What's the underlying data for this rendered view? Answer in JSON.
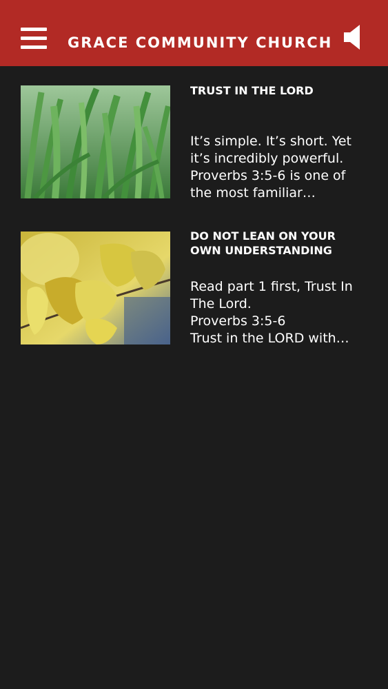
{
  "header": {
    "title": "GRACE COMMUNITY CHURCH",
    "menu_icon": "hamburger-menu-icon",
    "sound_icon": "speaker-icon",
    "background": "#b22a25"
  },
  "articles": [
    {
      "title": "TRUST IN THE LORD",
      "excerpt": "It’s simple. It’s short. Yet it’s incredibly powerful. Proverbs 3:5-6 is one of the most familiar…"
    },
    {
      "title": "DO NOT LEAN ON YOUR OWN UNDERSTANDING",
      "excerpt": "Read part 1 first, Trust In The Lord.\nProverbs 3:5-6\nTrust in the LORD with…"
    }
  ]
}
